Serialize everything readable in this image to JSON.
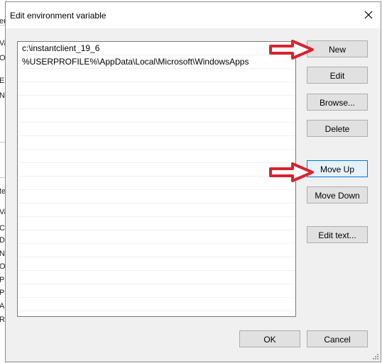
{
  "dialog": {
    "title": "Edit environment variable"
  },
  "background_fragments": [
    "er",
    "Va",
    "Or",
    "E",
    "N",
    "te",
    "Va",
    "Co",
    "Dr",
    "NU",
    "OS",
    "Pa",
    "Pa",
    "A",
    "R"
  ],
  "list": {
    "items": [
      "c:\\instantclient_19_6",
      "%USERPROFILE%\\AppData\\Local\\Microsoft\\WindowsApps"
    ]
  },
  "buttons": {
    "new": "New",
    "edit": "Edit",
    "browse": "Browse...",
    "delete": "Delete",
    "move_up": "Move Up",
    "move_down": "Move Down",
    "edit_text": "Edit text...",
    "ok": "OK",
    "cancel": "Cancel"
  },
  "colors": {
    "annotation_arrow": "#d9232e",
    "focus_border": "#0078d7"
  },
  "icons": [
    "close-icon",
    "red-arrow-icon",
    "resize-grip-icon"
  ]
}
